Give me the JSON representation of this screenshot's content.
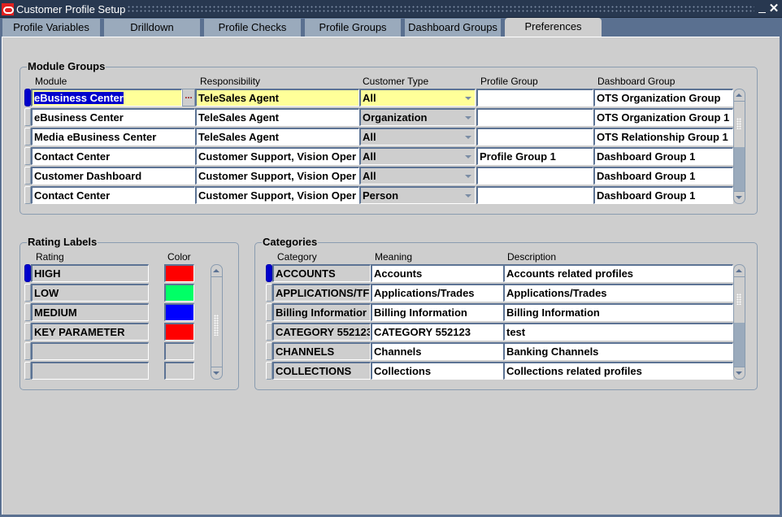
{
  "window": {
    "title": "Customer Profile Setup",
    "minimize_icon": "↙",
    "close_icon": "✕"
  },
  "tabs": [
    {
      "label": "Profile Variables",
      "active": false
    },
    {
      "label": "Drilldown",
      "active": false
    },
    {
      "label": "Profile Checks",
      "active": false
    },
    {
      "label": "Profile Groups",
      "active": false
    },
    {
      "label": "Dashboard Groups",
      "active": false
    },
    {
      "label": "Preferences",
      "active": true
    }
  ],
  "module_groups": {
    "title": "Module Groups",
    "columns": {
      "module": "Module",
      "responsibility": "Responsibility",
      "customer_type": "Customer Type",
      "profile_group": "Profile Group",
      "dashboard_group": "Dashboard Group"
    },
    "lov_button": "...",
    "rows": [
      {
        "module": "eBusiness Center",
        "responsibility": "TeleSales Agent",
        "customer_type": "All",
        "profile_group": "",
        "dashboard_group": "OTS Organization Group"
      },
      {
        "module": "eBusiness Center",
        "responsibility": "TeleSales Agent",
        "customer_type": "Organization",
        "profile_group": "",
        "dashboard_group": "OTS Organization Group 1"
      },
      {
        "module": "Media eBusiness Center",
        "responsibility": "TeleSales Agent",
        "customer_type": "All",
        "profile_group": "",
        "dashboard_group": "OTS Relationship Group 1"
      },
      {
        "module": "Contact Center",
        "responsibility": "Customer Support, Vision Oper",
        "customer_type": "All",
        "profile_group": "Profile Group 1",
        "dashboard_group": "Dashboard Group 1"
      },
      {
        "module": "Customer Dashboard",
        "responsibility": "Customer Support, Vision Oper",
        "customer_type": "All",
        "profile_group": "",
        "dashboard_group": "Dashboard Group 1"
      },
      {
        "module": "Contact Center",
        "responsibility": "Customer Support, Vision Oper",
        "customer_type": "Person",
        "profile_group": "",
        "dashboard_group": "Dashboard Group 1"
      }
    ]
  },
  "rating_labels": {
    "title": "Rating Labels",
    "columns": {
      "rating": "Rating",
      "color": "Color"
    },
    "rows": [
      {
        "rating": "HIGH",
        "color": "#ff0000"
      },
      {
        "rating": "LOW",
        "color": "#00ff66"
      },
      {
        "rating": "MEDIUM",
        "color": "#0000ff"
      },
      {
        "rating": "KEY PARAMETER",
        "color": "#ff0000"
      },
      {
        "rating": "",
        "color": ""
      },
      {
        "rating": "",
        "color": ""
      }
    ]
  },
  "categories": {
    "title": "Categories",
    "columns": {
      "category": "Category",
      "meaning": "Meaning",
      "description": "Description"
    },
    "rows": [
      {
        "category": "ACCOUNTS",
        "meaning": "Accounts",
        "description": "Accounts related profiles"
      },
      {
        "category": "APPLICATIONS/TF",
        "meaning": "Applications/Trades",
        "description": "Applications/Trades"
      },
      {
        "category": "Billing Informatior",
        "meaning": "Billing Information",
        "description": "Billing Information"
      },
      {
        "category": "CATEGORY 552123",
        "meaning": "CATEGORY 552123",
        "description": "test"
      },
      {
        "category": "CHANNELS",
        "meaning": "Channels",
        "description": "Banking Channels"
      },
      {
        "category": "COLLECTIONS",
        "meaning": "Collections",
        "description": "Collections related profiles"
      }
    ]
  },
  "colors": {
    "title_bar": "#283850",
    "frame": "#5a7090",
    "canvas": "#cecece",
    "selection": "#0000cc",
    "current_record": "#ffff99"
  }
}
